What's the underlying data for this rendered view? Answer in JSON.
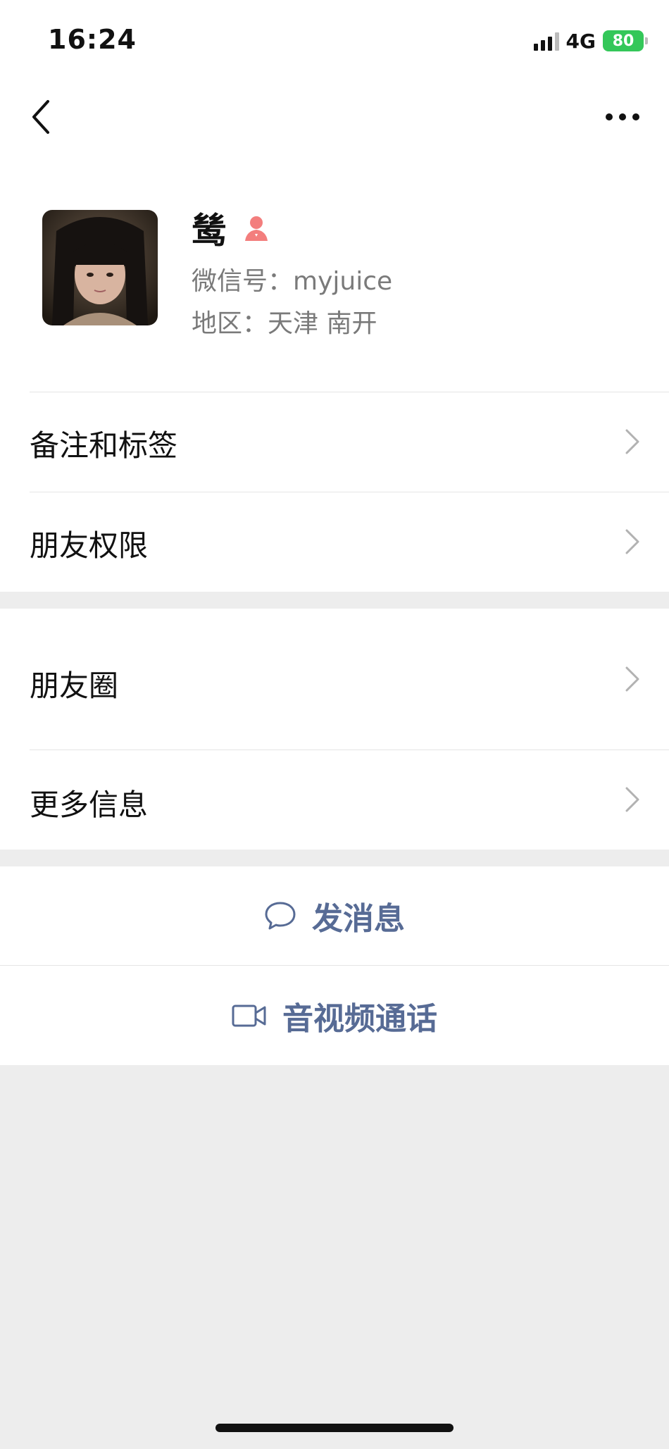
{
  "status_bar": {
    "time": "16:24",
    "network": "4G",
    "battery": "80"
  },
  "nav": {
    "back_icon": "chevron-left-icon",
    "more_icon": "more-dots-icon"
  },
  "profile": {
    "name": "鸶",
    "gender_icon": "female-icon",
    "wechat_id": "微信号：myjuice",
    "region": "地区：天津 南开"
  },
  "menu_group1": [
    {
      "label": "备注和标签"
    },
    {
      "label": "朋友权限"
    }
  ],
  "menu_group2": [
    {
      "label": "朋友圈"
    },
    {
      "label": "更多信息"
    }
  ],
  "actions": {
    "message": "发消息",
    "call": "音视频通话"
  },
  "colors": {
    "accent": "#576b95",
    "background": "#ededed",
    "female": "#f37e7d",
    "battery": "#34c759"
  }
}
